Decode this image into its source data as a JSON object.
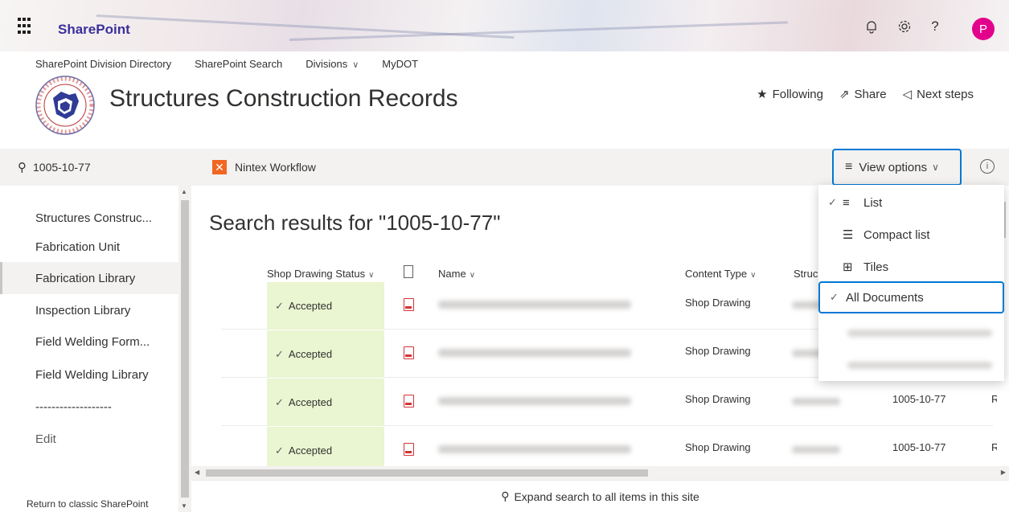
{
  "suite_bar": {
    "brand": "SharePoint",
    "help_glyph": "?",
    "avatar_initial": "P",
    "avatar_color": "#e3008c"
  },
  "site_nav": {
    "items": [
      "SharePoint Division Directory",
      "SharePoint Search",
      "Divisions",
      "MyDOT"
    ]
  },
  "site": {
    "title": "Structures Construction Records",
    "following_label": "Following",
    "share_label": "Share",
    "next_steps_label": "Next steps"
  },
  "search": {
    "query": "1005-10-77"
  },
  "left_nav": {
    "items": [
      "Structures Construc...",
      "Fabrication Unit",
      "Fabrication Library",
      "Inspection Library",
      "Field Welding Form...",
      "Field Welding Library",
      "-------------------",
      "Edit"
    ],
    "return_link": "Return to classic SharePoint"
  },
  "command_bar": {
    "nintex_label": "Nintex Workflow",
    "view_options_label": "View options",
    "accent": "#0078d4"
  },
  "results": {
    "title": "Search results for \"1005-10-77\"",
    "columns": {
      "status": "Shop Drawing Status",
      "name": "Name",
      "content_type": "Content Type",
      "structure": "Struc"
    },
    "rows": [
      {
        "status": "Accepted",
        "content_type": "Shop Drawing",
        "project": "",
        "extra": ""
      },
      {
        "status": "Accepted",
        "content_type": "Shop Drawing",
        "project": "",
        "extra": ""
      },
      {
        "status": "Accepted",
        "content_type": "Shop Drawing",
        "project": "1005-10-77",
        "extra": "R"
      },
      {
        "status": "Accepted",
        "content_type": "Shop Drawing",
        "project": "1005-10-77",
        "extra": "R"
      }
    ],
    "status_color": "#eaf5d1",
    "expand_label": "Expand search to all items in this site"
  },
  "view_menu": {
    "items": [
      {
        "label": "List",
        "icon": "list-icon",
        "checked": true
      },
      {
        "label": "Compact list",
        "icon": "compact-list-icon",
        "checked": false
      },
      {
        "label": "Tiles",
        "icon": "tiles-icon",
        "checked": false
      },
      {
        "label": "All Documents",
        "icon": "",
        "checked": true
      }
    ]
  }
}
